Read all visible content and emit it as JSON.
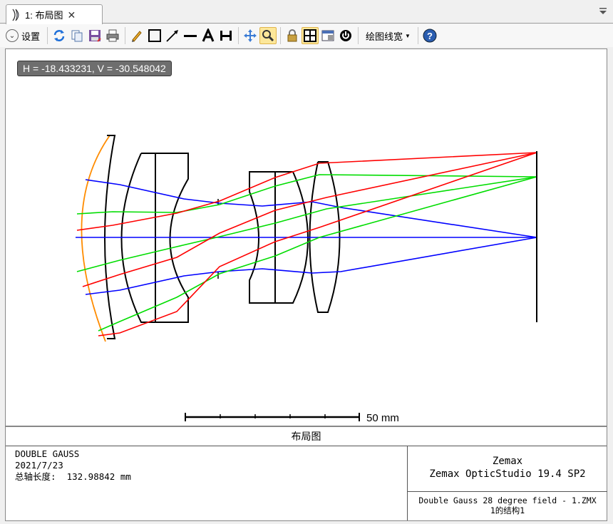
{
  "tab": {
    "label": "1: 布局图",
    "close": "✕"
  },
  "toolbar": {
    "settings_label": "设置",
    "linewidth_label": "绘图线宽"
  },
  "plot": {
    "cursor_readout": "H = -18.433231, V = -30.548042",
    "scale_label": "50 mm",
    "ray_colors": {
      "field1": "#0000ff",
      "field2": "#00dd00",
      "field3": "#ff0000"
    },
    "surface_color": "#000000",
    "object_surface_color": "#ff8c00"
  },
  "info": {
    "title": "布局图",
    "lens_name": "DOUBLE GAUSS",
    "date": "2021/7/23",
    "total_length": "总轴长度:  132.98842 mm",
    "company": "Zemax",
    "software": "Zemax OpticStudio 19.4 SP2",
    "file_name": "Double Gauss 28 degree field - 1.ZMX",
    "config": "1的结构1"
  }
}
